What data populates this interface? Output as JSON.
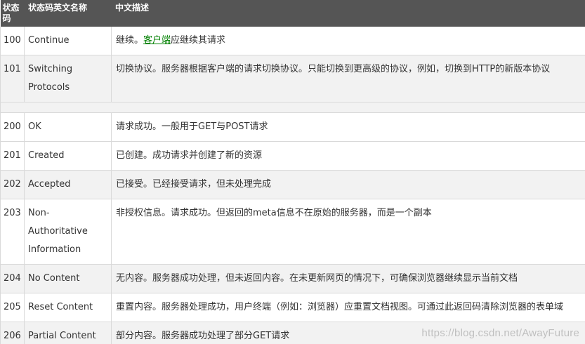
{
  "headers": {
    "code": "状态码",
    "name": "状态码英文名称",
    "desc": "中文描述"
  },
  "rows": [
    {
      "code": "100",
      "name": "Continue",
      "desc_pre": "继续。",
      "desc_link": "客户端",
      "desc_post": "应继续其请求"
    },
    {
      "code": "101",
      "name": "Switching Protocols",
      "desc": "切换协议。服务器根据客户端的请求切换协议。只能切换到更高级的协议，例如，切换到HTTP的新版本协议"
    },
    {
      "code": "200",
      "name": "OK",
      "desc": "请求成功。一般用于GET与POST请求"
    },
    {
      "code": "201",
      "name": "Created",
      "desc": "已创建。成功请求并创建了新的资源"
    },
    {
      "code": "202",
      "name": "Accepted",
      "desc": "已接受。已经接受请求，但未处理完成"
    },
    {
      "code": "203",
      "name": "Non-Authoritative Information",
      "desc": "非授权信息。请求成功。但返回的meta信息不在原始的服务器，而是一个副本"
    },
    {
      "code": "204",
      "name": "No Content",
      "desc": "无内容。服务器成功处理，但未返回内容。在未更新网页的情况下，可确保浏览器继续显示当前文档"
    },
    {
      "code": "205",
      "name": "Reset Content",
      "desc": "重置内容。服务器处理成功，用户终端（例如：浏览器）应重置文档视图。可通过此返回码清除浏览器的表单域"
    },
    {
      "code": "206",
      "name": "Partial Content",
      "desc": "部分内容。服务器成功处理了部分GET请求"
    }
  ],
  "watermark": "https://blog.csdn.net/AwayFuture"
}
